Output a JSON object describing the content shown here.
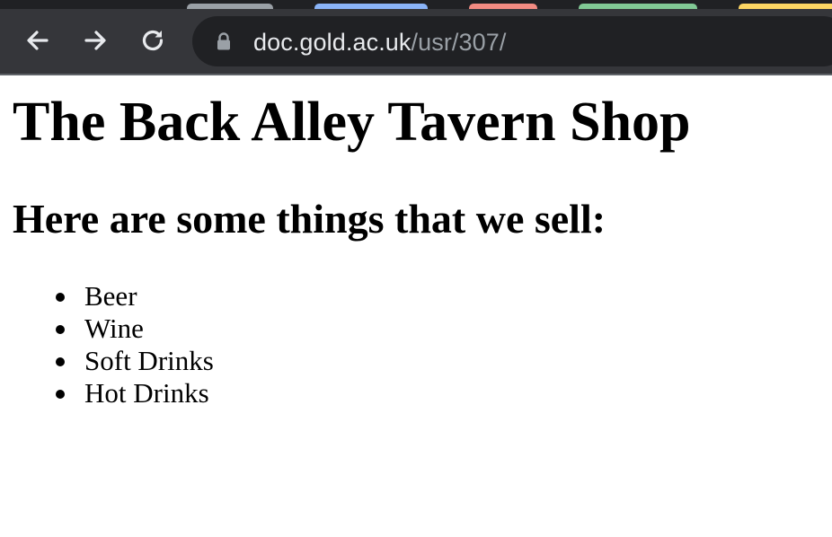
{
  "browser": {
    "tab_colors": [
      "#9aa0a6",
      "#8ab4f8",
      "#f28b82",
      "#81c995",
      "#fdd663"
    ],
    "address_bar": {
      "host": "doc.gold.ac.uk",
      "path": "/usr/307/"
    },
    "buttons": {
      "back_icon": "arrow-left-icon",
      "forward_icon": "arrow-right-icon",
      "reload_icon": "reload-icon"
    }
  },
  "page": {
    "title": "The Back Alley Tavern Shop",
    "subtitle": "Here are some things that we sell:",
    "items": [
      "Beer",
      "Wine",
      "Soft Drinks",
      "Hot Drinks"
    ]
  }
}
